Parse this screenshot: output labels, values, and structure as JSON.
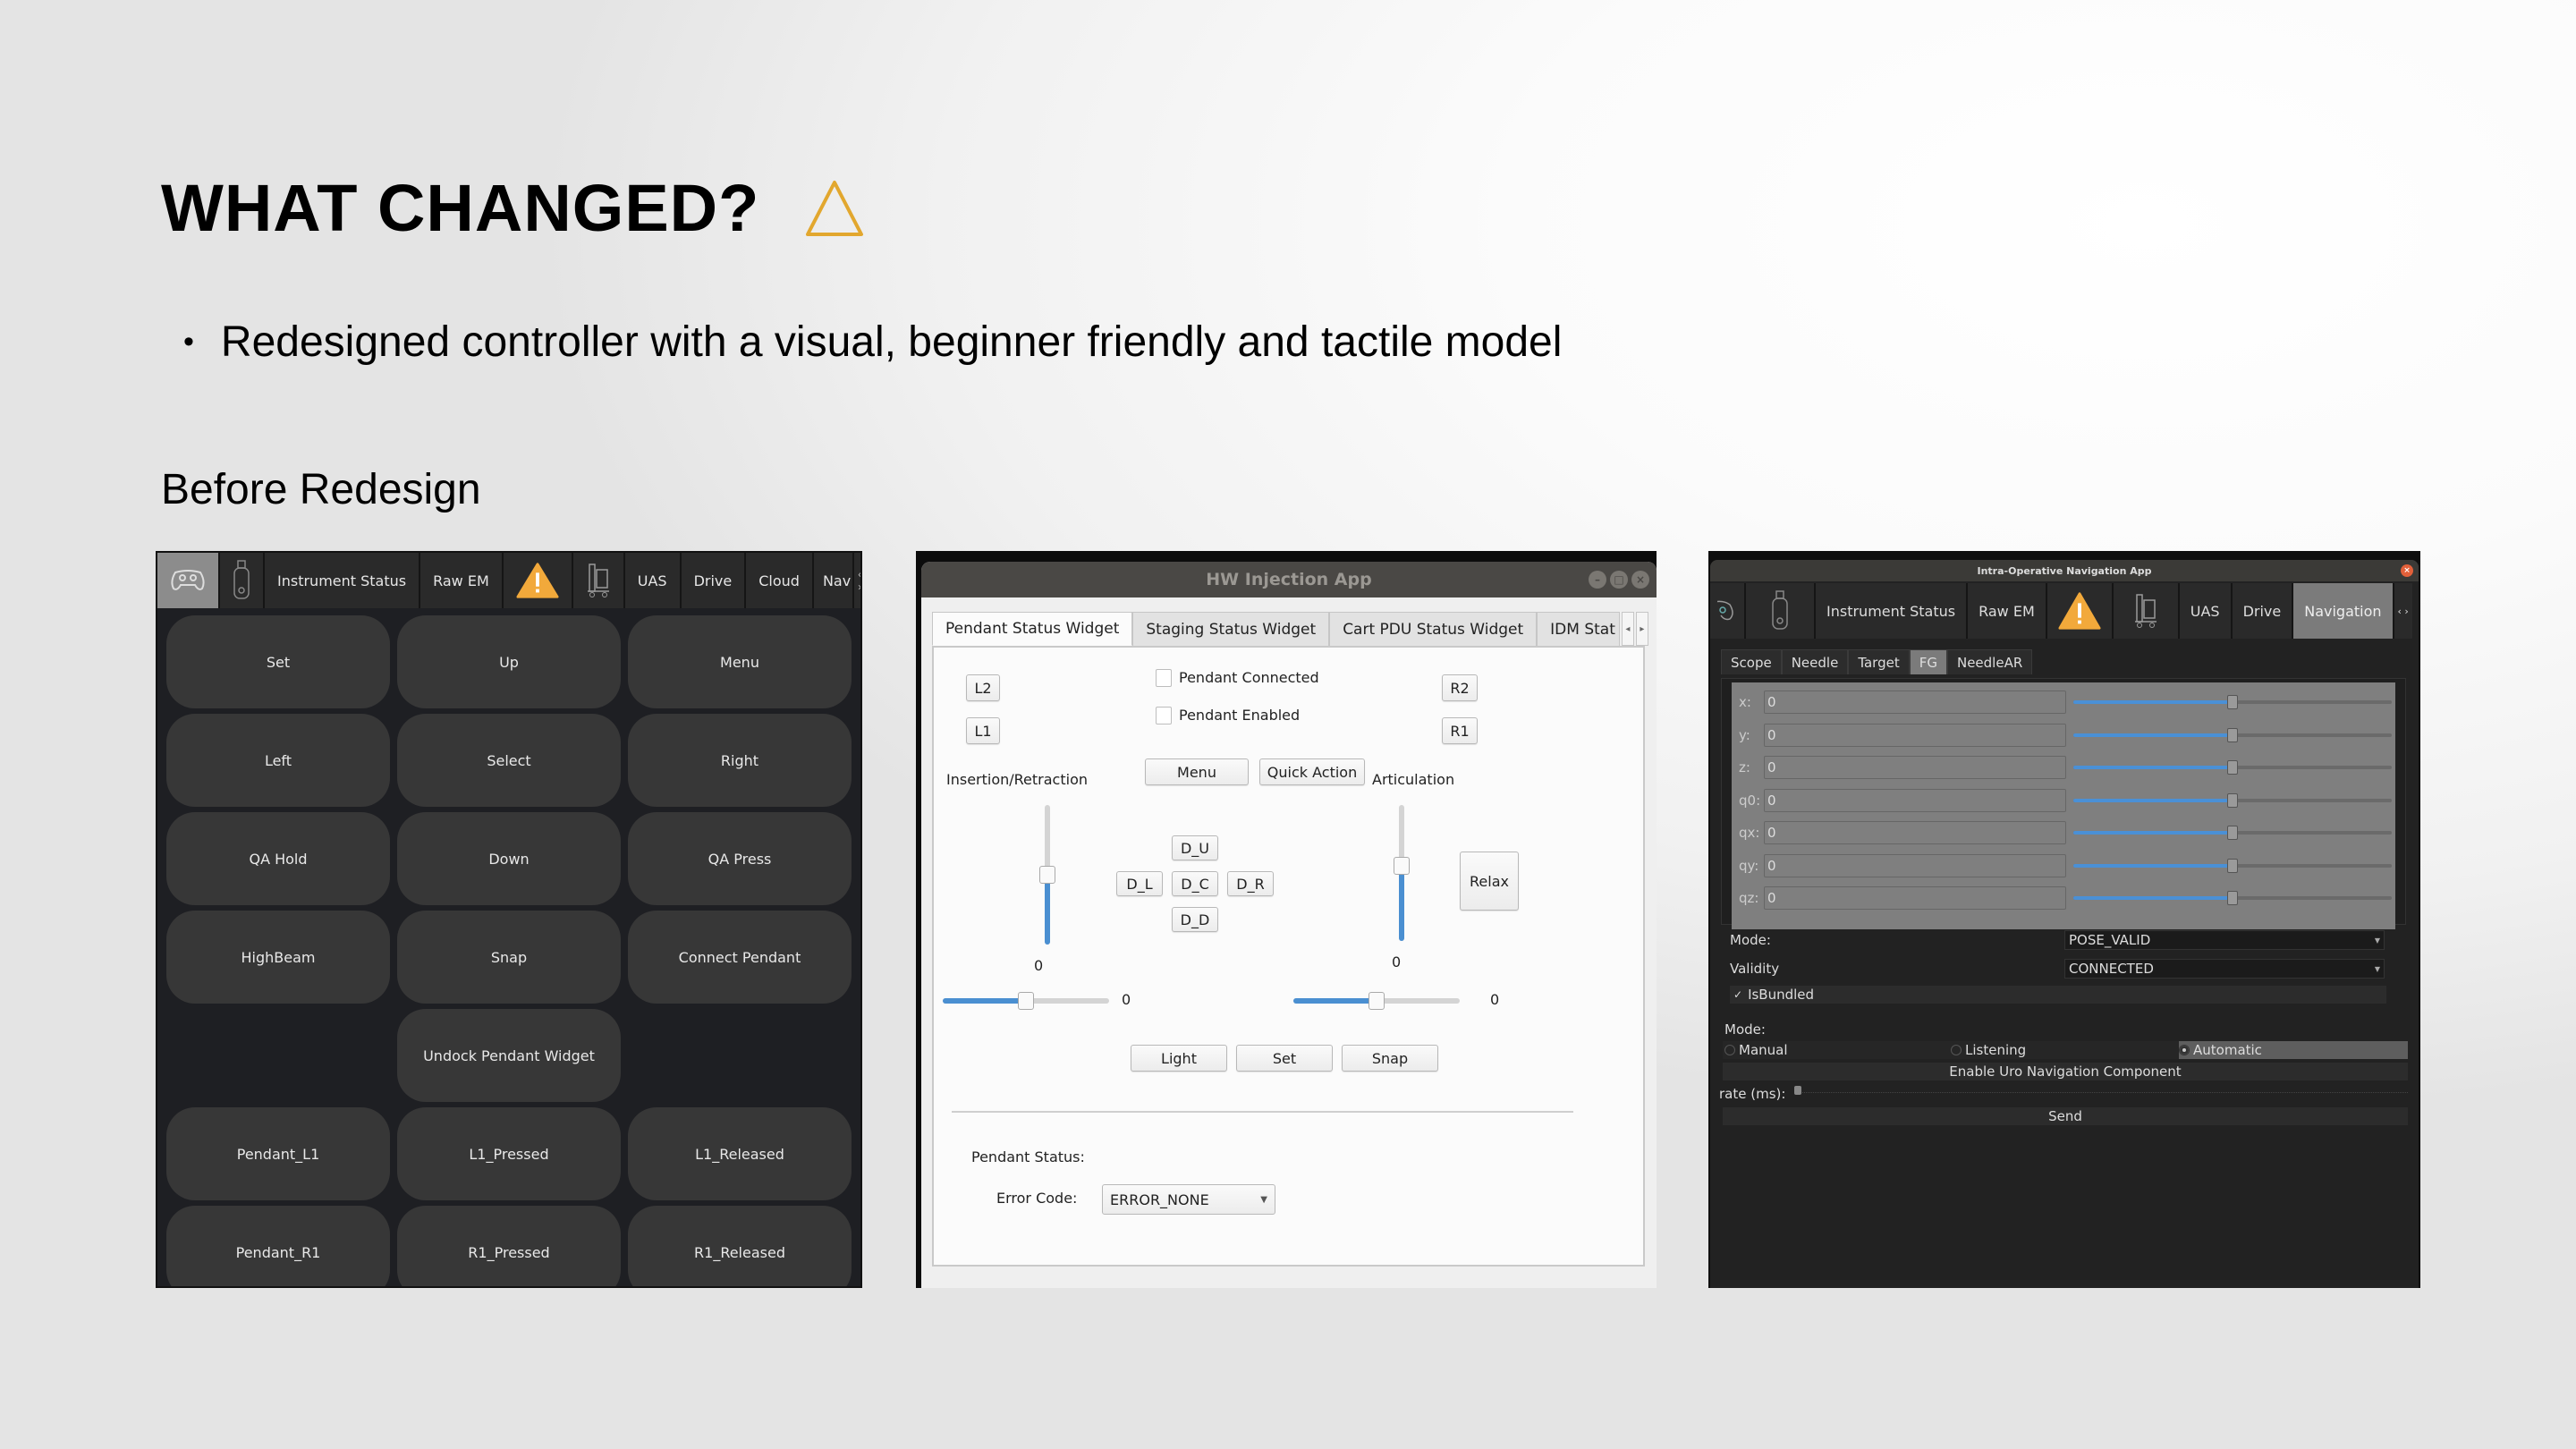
{
  "slide": {
    "title": "WHAT CHANGED?",
    "title_icon": "warning-triangle-outline-icon",
    "accent_color": "#E2A72E",
    "bullet": "Redesigned controller with a visual, beginner friendly and tactile model",
    "section_label": "Before Redesign"
  },
  "panel1": {
    "toolbar": {
      "items": [
        {
          "type": "icon",
          "icon": "gamepad-icon",
          "active": true
        },
        {
          "type": "icon",
          "icon": "usb-drive-icon"
        },
        {
          "type": "text",
          "label": "Instrument Status"
        },
        {
          "type": "text",
          "label": "Raw EM"
        },
        {
          "type": "icon",
          "icon": "warning-icon",
          "color": "#F2A93B"
        },
        {
          "type": "icon",
          "icon": "robot-cart-icon"
        },
        {
          "type": "text",
          "label": "UAS"
        },
        {
          "type": "text",
          "label": "Drive"
        },
        {
          "type": "text",
          "label": "Cloud"
        },
        {
          "type": "text",
          "label": "Nav"
        }
      ],
      "scroll_arrows": "‹ ›"
    },
    "buttons": [
      "Set",
      "Up",
      "Menu",
      "Left",
      "Select",
      "Right",
      "QA Hold",
      "Down",
      "QA Press",
      "HighBeam",
      "Snap",
      "Connect Pendant",
      "",
      "Undock Pendant Widget",
      "",
      "Pendant_L1",
      "L1_Pressed",
      "L1_Released",
      "Pendant_R1",
      "R1_Pressed",
      "R1_Released"
    ]
  },
  "panel2": {
    "window_title": "HW Injection App",
    "tabs": [
      "Pendant Status Widget",
      "Staging Status Widget",
      "Cart PDU Status Widget",
      "IDM Stat"
    ],
    "active_tab": 0,
    "buttons": {
      "l2": "L2",
      "l1": "L1",
      "r2": "R2",
      "r1": "R1",
      "menu": "Menu",
      "quick_action": "Quick Action",
      "d_up": "D_U",
      "d_left": "D_L",
      "d_center": "D_C",
      "d_right": "D_R",
      "d_down": "D_D",
      "relax": "Relax",
      "light": "Light",
      "set": "Set",
      "snap": "Snap"
    },
    "checkboxes": [
      {
        "label": "Pendant Connected",
        "checked": false
      },
      {
        "label": "Pendant Enabled",
        "checked": false
      }
    ],
    "insertion_label": "Insertion/Retraction",
    "articulation_label": "Articulation",
    "insertion_vertical_value": "0",
    "insertion_vertical_fraction": 0.5,
    "articulation_vertical_value": "0",
    "articulation_vertical_fraction": 0.55,
    "insertion_horizontal_value": "0",
    "insertion_horizontal_fraction": 0.5,
    "articulation_horizontal_value": "0",
    "articulation_horizontal_fraction": 0.5,
    "pendant_status_label": "Pendant Status:",
    "error_code_label": "Error Code:",
    "error_code_value": "ERROR_NONE"
  },
  "panel3": {
    "window_title": "Intra-Operative Navigation App",
    "toolbar": {
      "items": [
        {
          "type": "icon",
          "icon": "gamepad-icon"
        },
        {
          "type": "icon",
          "icon": "usb-drive-icon"
        },
        {
          "type": "text",
          "label": "Instrument Status"
        },
        {
          "type": "text",
          "label": "Raw EM"
        },
        {
          "type": "icon",
          "icon": "warning-icon",
          "color": "#F2A93B"
        },
        {
          "type": "icon",
          "icon": "robot-cart-icon"
        },
        {
          "type": "text",
          "label": "UAS"
        },
        {
          "type": "text",
          "label": "Drive"
        },
        {
          "type": "text",
          "label": "Navigation",
          "active": true
        }
      ],
      "scroll_arrows": "‹ ›"
    },
    "subtabs": [
      "Scope",
      "Needle",
      "Target",
      "FG",
      "NeedleAR"
    ],
    "active_subtab": 3,
    "fields": [
      {
        "label": "x:",
        "value": "0",
        "slider_fraction": 0.5
      },
      {
        "label": "y:",
        "value": "0",
        "slider_fraction": 0.5
      },
      {
        "label": "z:",
        "value": "0",
        "slider_fraction": 0.5
      },
      {
        "label": "q0:",
        "value": "0",
        "slider_fraction": 0.5
      },
      {
        "label": "qx:",
        "value": "0",
        "slider_fraction": 0.5
      },
      {
        "label": "qy:",
        "value": "0",
        "slider_fraction": 0.5
      },
      {
        "label": "qz:",
        "value": "0",
        "slider_fraction": 0.5
      }
    ],
    "mode_label": "Mode:",
    "mode_value": "POSE_VALID",
    "validity_label": "Validity",
    "validity_value": "CONNECTED",
    "is_bundled_label": "IsBundled",
    "is_bundled_checked": true,
    "mode2_label": "Mode:",
    "radio_options": [
      "Manual",
      "Listening",
      "Automatic"
    ],
    "radio_selected": 2,
    "enable_button": "Enable Uro Navigation Component",
    "rate_label": "rate (ms):",
    "rate_fraction": 0.0,
    "send_button": "Send"
  }
}
